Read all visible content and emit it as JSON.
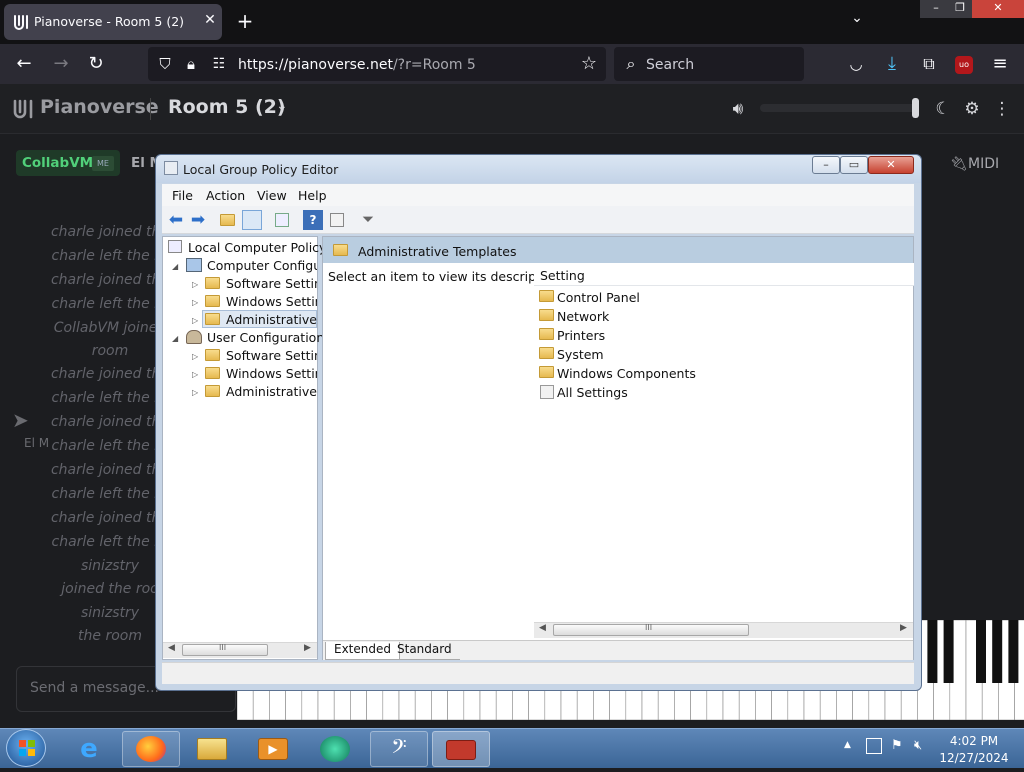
{
  "browser": {
    "tab_title": "Pianoverse - Room 5 (2)",
    "close_tab_icon": "close-icon",
    "new_tab_icon": "plus-icon",
    "url_host": "https://pianoverse.net",
    "url_path": "/?r=Room 5",
    "search_placeholder": "Search",
    "window_controls": {
      "minimize": "–",
      "maximize": "❐",
      "close": "✕"
    }
  },
  "pianoverse": {
    "brand": "Pianoverse",
    "room": "Room 5 (2)",
    "users": [
      {
        "name": "CollabVM",
        "tag": "ME"
      },
      {
        "name": "El M"
      }
    ],
    "midi_label": "MIDI",
    "volume_level": 1.0,
    "chat": [
      "charle joined the",
      "charle left the ro",
      "charle joined the",
      "charle left the ro",
      "CollabVM joined",
      "room",
      "charle joined the",
      "charle left the ro",
      "charle joined the",
      "charle left the ro",
      "charle joined the",
      "charle left the ro",
      "charle joined the",
      "charle left the ro",
      "sinizstry",
      "joined the roo",
      "sinizstry",
      "the room"
    ],
    "cursor_label": "El M",
    "chat_placeholder": "Send a message..."
  },
  "gpe": {
    "title": "Local Group Policy Editor",
    "menu": [
      "File",
      "Action",
      "View",
      "Help"
    ],
    "tree": {
      "root": "Local Computer Policy",
      "computer": "Computer Configura",
      "computer_children": [
        "Software Settings",
        "Windows Setting",
        "Administrative Te"
      ],
      "user": "User Configuration",
      "user_children": [
        "Software Settings",
        "Windows Setting",
        "Administrative Te"
      ]
    },
    "right": {
      "header": "Administrative Templates",
      "description": "Select an item to view its description.",
      "column": "Setting",
      "items": [
        "Control Panel",
        "Network",
        "Printers",
        "System",
        "Windows Components",
        "All Settings"
      ]
    },
    "tabs": [
      "Extended",
      "Standard"
    ],
    "scroll_grip": "III"
  },
  "taskbar": {
    "time": "4:02 PM",
    "date": "12/27/2024"
  }
}
